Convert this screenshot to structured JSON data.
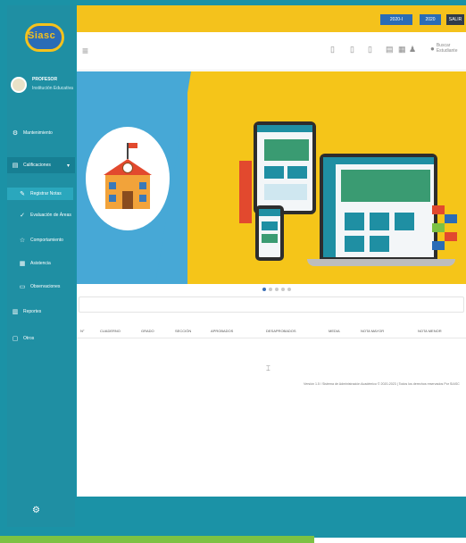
{
  "app": {
    "logo_text": "Siasc"
  },
  "user": {
    "name": "PROFESOR",
    "role": "Institución Educativa"
  },
  "sidebar": {
    "items": [
      {
        "label": "Mantenimiento",
        "icon": "wrench-icon"
      },
      {
        "label": "Calificaciones",
        "icon": "document-icon"
      },
      {
        "label": "Registrar Notas",
        "icon": "pencil-icon"
      },
      {
        "label": "Evaluación de Áreas",
        "icon": "check-icon"
      },
      {
        "label": "Comportamiento",
        "icon": "star-icon"
      },
      {
        "label": "Asistencia",
        "icon": "calendar-icon"
      },
      {
        "label": "Observaciones",
        "icon": "note-icon"
      },
      {
        "label": "Reportes",
        "icon": "chart-icon"
      },
      {
        "label": "Otros",
        "icon": "folder-icon"
      }
    ]
  },
  "topbar": {
    "pills": [
      "2020-I",
      "2020",
      "SALIR"
    ]
  },
  "toolbar": {
    "search_placeholder": "Buscar Estudiante"
  },
  "table": {
    "headers": [
      "N°",
      "CUADERNO",
      "GRADO",
      "SECCIÓN",
      "APROBADOS",
      "DESAPROBADOS",
      "MEDIA",
      "NOTA MAYOR",
      "NOTA MENOR"
    ]
  },
  "footer": {
    "text": "Versión 1.5 / Sistema de Administración Académico © 2020-2023 | Todos los derechos reservados Por SIASC"
  }
}
